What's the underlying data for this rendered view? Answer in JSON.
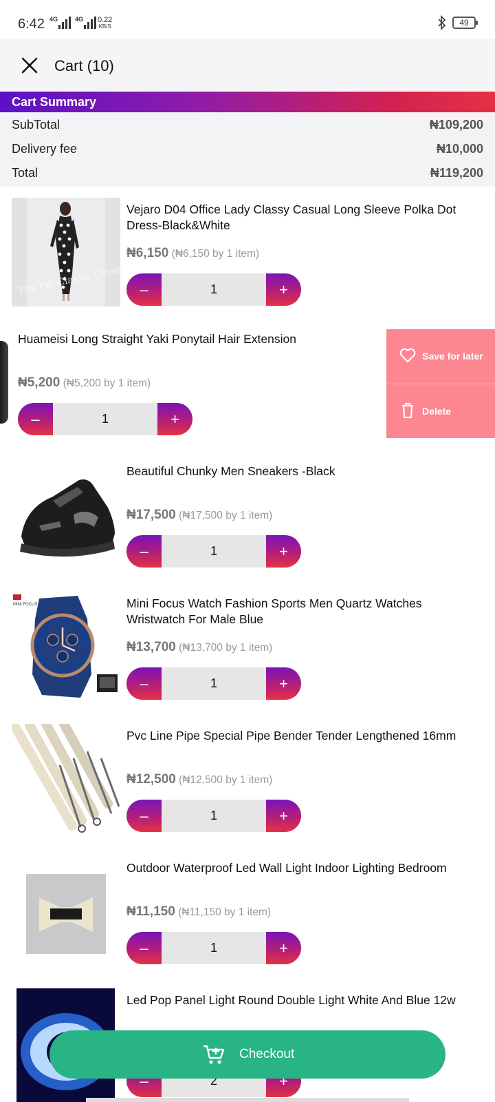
{
  "status_bar": {
    "time": "6:42",
    "network_1": "4G",
    "network_2": "4G",
    "speed_value": "0.22",
    "speed_unit": "KB/S",
    "battery": "49",
    "icons": [
      "bluetooth-icon",
      "battery-icon",
      "signal-icon"
    ]
  },
  "header": {
    "title": "Cart (10)",
    "close_icon": "close-icon"
  },
  "summary": {
    "heading": "Cart Summary",
    "rows": [
      {
        "label": "SubTotal",
        "value": "₦109,200"
      },
      {
        "label": "Delivery fee",
        "value": "₦10,000"
      },
      {
        "label": "Total",
        "value": "₦119,200"
      }
    ]
  },
  "items": [
    {
      "title": "Vejaro D04 Office Lady Classy Casual Long Sleeve Polka Dot Dress-Black&White",
      "price": "₦6,150",
      "detail": "(₦6,150 by 1 item)",
      "qty": "1",
      "thumb_watermark": "The Pin Classic Closet"
    },
    {
      "title": "Huameisi Long Straight Yaki Ponytail Hair Extension",
      "price": "₦5,200",
      "detail": "(₦5,200 by 1 item)",
      "qty": "1"
    },
    {
      "title": "Beautiful Chunky Men Sneakers -Black",
      "price": "₦17,500",
      "detail": "(₦17,500 by 1 item)",
      "qty": "1"
    },
    {
      "title": "Mini Focus Watch Fashion Sports Men Quartz Watches Wristwatch For Male Blue",
      "price": "₦13,700",
      "detail": "(₦13,700 by 1 item)",
      "qty": "1",
      "thumb_brand": "MINI FOCUS"
    },
    {
      "title": "Pvc Line Pipe Special Pipe Bender Tender Lengthened 16mm",
      "price": "₦12,500",
      "detail": "(₦12,500 by 1 item)",
      "qty": "1"
    },
    {
      "title": "Outdoor Waterproof Led Wall Light Indoor Lighting Bedroom",
      "price": "₦11,150",
      "detail": "(₦11,150 by 1 item)",
      "qty": "1"
    },
    {
      "title": "Led Pop Panel Light Round Double Light White And Blue 12w",
      "qty": "2"
    }
  ],
  "qty_controls": {
    "minus": "–",
    "plus": "+"
  },
  "swipe_actions": {
    "save_label": "Save for later",
    "delete_label": "Delete",
    "color": "#fc8790"
  },
  "checkout": {
    "label": "Checkout",
    "color": "#28b485"
  },
  "colors": {
    "accent_start": "#5b12c4",
    "accent_end": "#e33244",
    "checkout": "#28b485"
  }
}
